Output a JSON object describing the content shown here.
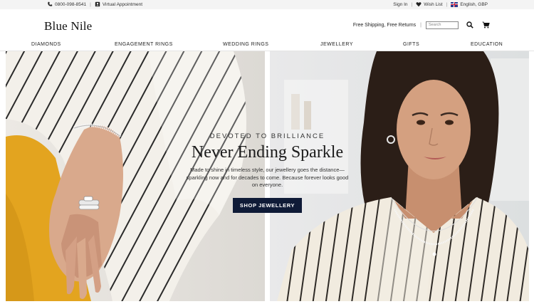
{
  "utility": {
    "phone": "0800-098-8541",
    "virtual_appointment": "Virtual Appointment",
    "sign_in": "Sign In",
    "wish_list": "Wish List",
    "locale": "English, GBP"
  },
  "header": {
    "logo": "Blue Nile",
    "shipping_note": "Free Shipping, Free Returns",
    "search_placeholder": "Search"
  },
  "nav": {
    "items": [
      {
        "label": "DIAMONDS"
      },
      {
        "label": "ENGAGEMENT RINGS"
      },
      {
        "label": "WEDDING RINGS"
      },
      {
        "label": "JEWELLERY"
      },
      {
        "label": "GIFTS"
      },
      {
        "label": "EDUCATION"
      }
    ]
  },
  "hero": {
    "eyebrow": "DEVOTED TO BRILLIANCE",
    "headline": "Never Ending Sparkle",
    "body": "Made to shine in timeless style, our jewellery goes the distance—sparkling now and for decades to come. Because forever looks good on everyone.",
    "cta": "SHOP JEWELLERY"
  },
  "colors": {
    "cta_bg": "#0f1b37",
    "utility_bg": "#f4f4f4",
    "mustard": "#e3a41f"
  }
}
